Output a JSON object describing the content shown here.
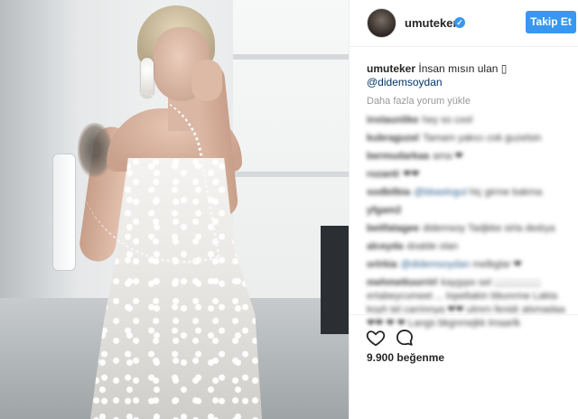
{
  "post": {
    "username": "umuteker",
    "follow_label": "Takip Et",
    "verified_glyph": "✓",
    "caption_user": "umuteker",
    "caption_text": "İnsan mısın ulan ▯",
    "mention": "@didemsoydan",
    "load_more": "Daha fazla yorum yükle",
    "likes": "9.900 beğenme"
  },
  "comments": [
    {
      "user": "instaunlike",
      "text": "hey so cool"
    },
    {
      "user": "kubraguzel",
      "text": "Tamam yakıcı cok guzelsin"
    },
    {
      "user": "bermudarkaa",
      "text": "ama ❤"
    },
    {
      "user": "rozanti",
      "text": "❤❤"
    },
    {
      "user": "sodbilbia",
      "mention": "@bbaslogul",
      "text": "hiç girme bakma"
    },
    {
      "user": "yfgam2",
      "text": ""
    },
    {
      "user": "beitfatagee",
      "text": "didemsoy Tadjkke sirla dedıya"
    },
    {
      "user": "alceyda",
      "text": "doalde olan"
    },
    {
      "user": "orlrkia",
      "mention": "@didemsoydan",
      "text": "melbglar ❤"
    },
    {
      "user": "mehmettuurrirl",
      "text": "kaygıpo sel ;;;;;;;;;;;;;;;;; ertabeycumeet ... lopeltakin bbunrme Lakta koyh tel carrinnya ❤❤ ulmrn fenidr alsmadaa ❤❤ ❤ ❤ Langs bkgnmejkk lmaarlk"
    }
  ],
  "icons": {
    "avatar": "avatar-image",
    "verified": "verified-badge-icon",
    "like": "heart-icon",
    "comment": "comment-bubble-icon"
  },
  "colors": {
    "accent": "#3897f0",
    "mention": "#003569",
    "muted": "#999999",
    "text": "#262626"
  }
}
